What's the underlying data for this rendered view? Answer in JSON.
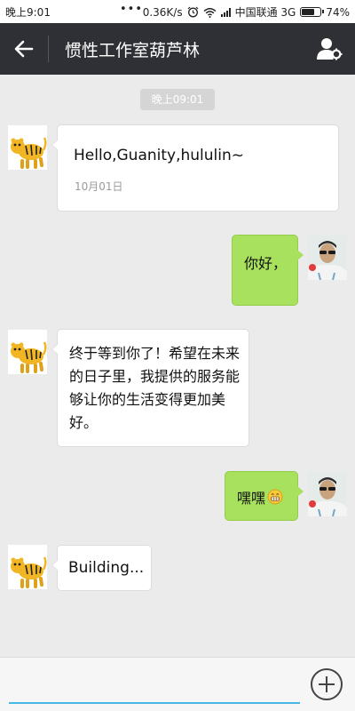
{
  "status_bar": {
    "time": "晚上9:01",
    "speed": "0.36K/s",
    "carrier": "中国联通 3G",
    "battery": "74%",
    "battery_level": 0.74,
    "icons": [
      "alarm-icon",
      "wifi-icon",
      "signal-icon",
      "battery-icon"
    ]
  },
  "header": {
    "title": "惯性工作室葫芦林",
    "back_icon": "back-arrow-icon",
    "profile_icon": "profile-settings-icon"
  },
  "chat": {
    "timestamp": "晚上09:01",
    "messages": [
      {
        "sender": "bot",
        "text": "Hello,Guanity,hululin~",
        "sub": "10月01日"
      },
      {
        "sender": "user",
        "text": "你好，"
      },
      {
        "sender": "bot",
        "text": "终于等到你了！希望在未来的日子里，我提供的服务能够让你的生活变得更加美好。"
      },
      {
        "sender": "user",
        "text": "嘿嘿",
        "emoji": "grinning-emoji"
      },
      {
        "sender": "bot",
        "text": "Building..."
      }
    ]
  },
  "input_bar": {
    "value": "",
    "add_icon": "plus-circle-icon"
  },
  "colors": {
    "header_bg": "#2f3035",
    "chat_bg": "#ebebeb",
    "user_bubble": "#a8e15d",
    "input_underline": "#45b8e6"
  }
}
